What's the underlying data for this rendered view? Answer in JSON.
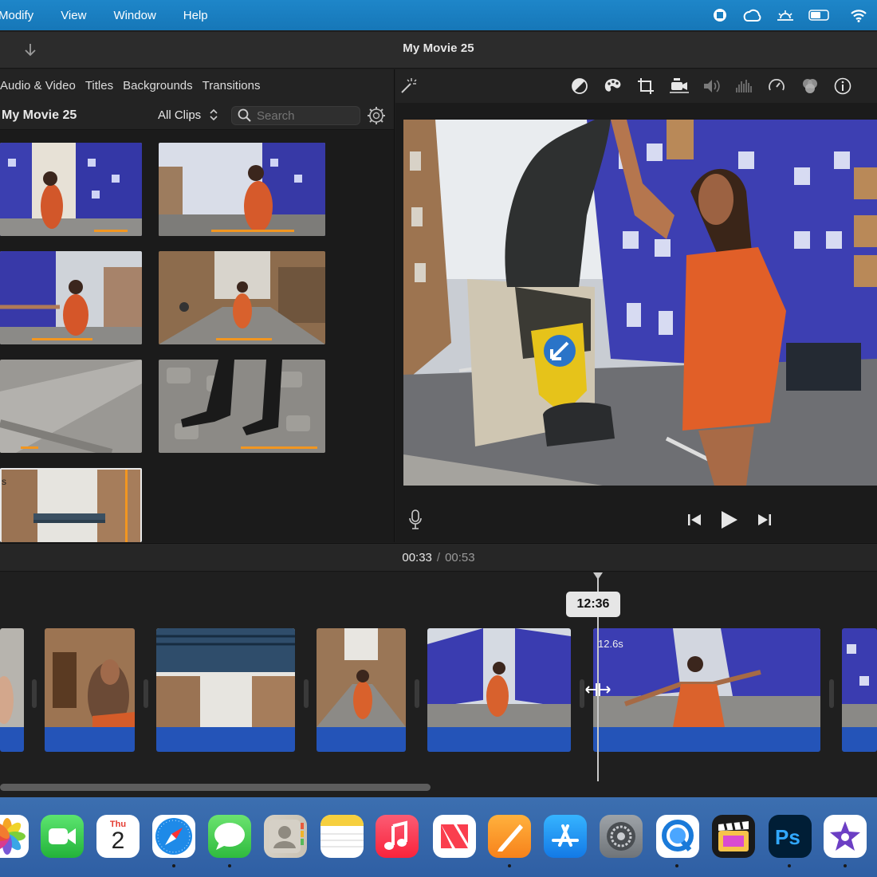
{
  "menubar": {
    "items": [
      "Modify",
      "View",
      "Window",
      "Help"
    ]
  },
  "toolbar": {
    "title": "My Movie 25"
  },
  "browser": {
    "tabs": [
      "Audio & Video",
      "Titles",
      "Backgrounds",
      "Transitions"
    ],
    "library_name": "My Movie 25",
    "filter_label": "All Clips",
    "search_placeholder": "Search",
    "clip_badge": "s"
  },
  "viewer": {
    "tools": [
      "magic-wand-icon",
      "color-balance-icon",
      "color-correction-icon",
      "crop-icon",
      "stabilization-icon",
      "volume-icon",
      "noise-reduction-icon",
      "speed-icon",
      "clip-filter-icon",
      "info-icon"
    ]
  },
  "timeline": {
    "current_time": "00:33",
    "separator": "/",
    "total_time": "00:53",
    "playhead_label": "12:36",
    "clip_length": "12.6s"
  },
  "dock": {
    "calendar_month": "Thu",
    "calendar_day": "2",
    "apps": [
      "Photos",
      "FaceTime",
      "Calendar",
      "Safari",
      "Messages",
      "Contacts",
      "Notes",
      "Music",
      "News",
      "Pages",
      "App Store",
      "System Settings",
      "QuickTime Player",
      "Final Cut Pro",
      "Photoshop",
      "iMovie"
    ]
  },
  "colors": {
    "accent_orange": "#f29620",
    "audio_blue": "#2454b8",
    "menubar_blue": "#1a7fc0"
  }
}
